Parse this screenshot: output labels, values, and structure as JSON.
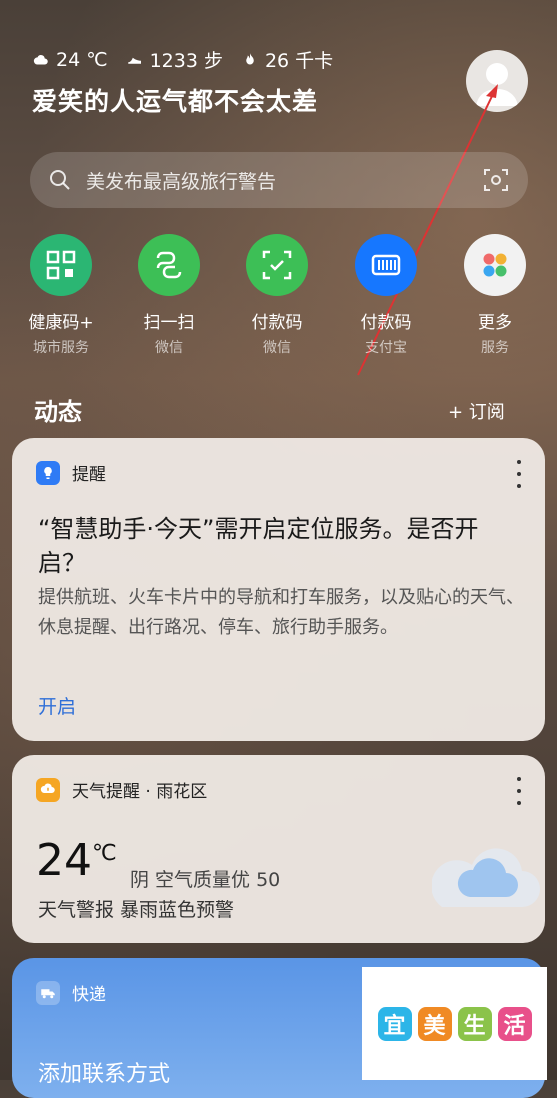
{
  "status": {
    "weather_icon": "cloud-icon",
    "temperature": "24 ℃",
    "steps": "1233 步",
    "calories": "26 千卡"
  },
  "tagline": "爱笑的人运气都不会太差",
  "search": {
    "placeholder": "美发布最高级旅行警告"
  },
  "apps": [
    {
      "label": "健康码+",
      "sub": "城市服务",
      "color": "#2bb673"
    },
    {
      "label": "扫一扫",
      "sub": "微信",
      "color": "#3dbf56"
    },
    {
      "label": "付款码",
      "sub": "微信",
      "color": "#3dbf56"
    },
    {
      "label": "付款码",
      "sub": "支付宝",
      "color": "#1677ff"
    },
    {
      "label": "更多",
      "sub": "服务",
      "color": "#f2f2f2"
    }
  ],
  "feed": {
    "title": "动态",
    "subscribe": "+ 订阅"
  },
  "reminder_card": {
    "head": "提醒",
    "title": "“智慧助手·今天”需开启定位服务。是否开启？",
    "body": "提供航班、火车卡片中的导航和打车服务，以及贴心的天气、休息提醒、出行路况、停车、旅行助手服务。",
    "action": "开启"
  },
  "weather_card": {
    "head": "天气提醒 · 雨花区",
    "temp": "24",
    "unit": "℃",
    "desc": "阴  空气质量优  50",
    "warning": "天气警报 暴雨蓝色预警"
  },
  "express_card": {
    "head": "快递",
    "action": "添加联系方式"
  },
  "watermark": [
    "宜",
    "美",
    "生",
    "活"
  ],
  "colors": {
    "accent": "#2f6fd8",
    "alert": "#f5a623",
    "info": "#2f7bf5"
  }
}
